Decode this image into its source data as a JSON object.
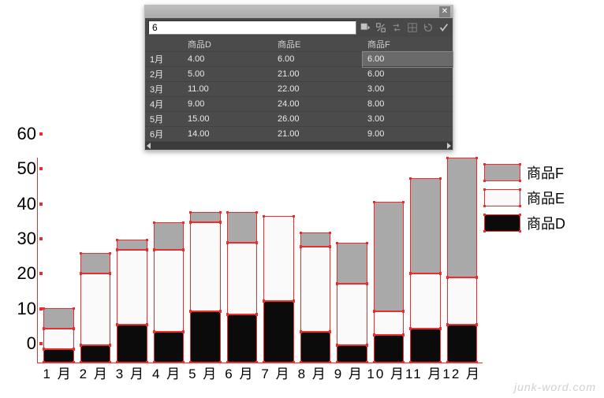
{
  "panel": {
    "input_value": "6",
    "columns": [
      "商品D",
      "商品E",
      "商品F"
    ],
    "rows": [
      {
        "month": "1月",
        "d": "4.00",
        "e": "6.00",
        "f": "6.00"
      },
      {
        "month": "2月",
        "d": "5.00",
        "e": "21.00",
        "f": "6.00"
      },
      {
        "month": "3月",
        "d": "11.00",
        "e": "22.00",
        "f": "3.00"
      },
      {
        "month": "4月",
        "d": "9.00",
        "e": "24.00",
        "f": "8.00"
      },
      {
        "month": "5月",
        "d": "15.00",
        "e": "26.00",
        "f": "3.00"
      },
      {
        "month": "6月",
        "d": "14.00",
        "e": "21.00",
        "f": "9.00"
      }
    ],
    "selected_cell": {
      "row": 0,
      "col": "f"
    }
  },
  "legend": {
    "items": [
      {
        "label": "商品F",
        "class": "swF"
      },
      {
        "label": "商品E",
        "class": "swE"
      },
      {
        "label": "商品D",
        "class": "swD"
      }
    ]
  },
  "yticks": [
    0,
    10,
    20,
    30,
    40,
    50,
    60
  ],
  "xlabels": [
    "1 月",
    "2 月",
    "3 月",
    "4 月",
    "5 月",
    "6 月",
    "7 月",
    "8 月",
    "9 月",
    "10 月",
    "11 月",
    "12 月"
  ],
  "watermark": "junk-word.com",
  "chart_data": {
    "type": "bar",
    "stacked": true,
    "title": "",
    "xlabel": "",
    "ylabel": "",
    "ylim": [
      0,
      60
    ],
    "categories": [
      "1月",
      "2月",
      "3月",
      "4月",
      "5月",
      "6月",
      "7月",
      "8月",
      "9月",
      "10月",
      "11月",
      "12月"
    ],
    "series": [
      {
        "name": "商品D",
        "values": [
          4,
          5,
          11,
          9,
          15,
          14,
          18,
          9,
          5,
          8,
          10,
          11
        ]
      },
      {
        "name": "商品E",
        "values": [
          6,
          21,
          22,
          24,
          26,
          21,
          25,
          25,
          18,
          7,
          16,
          14
        ]
      },
      {
        "name": "商品F",
        "values": [
          6,
          6,
          3,
          8,
          3,
          9,
          0,
          4,
          12,
          32,
          28,
          35
        ]
      }
    ],
    "legend_position": "right",
    "grid": false
  }
}
